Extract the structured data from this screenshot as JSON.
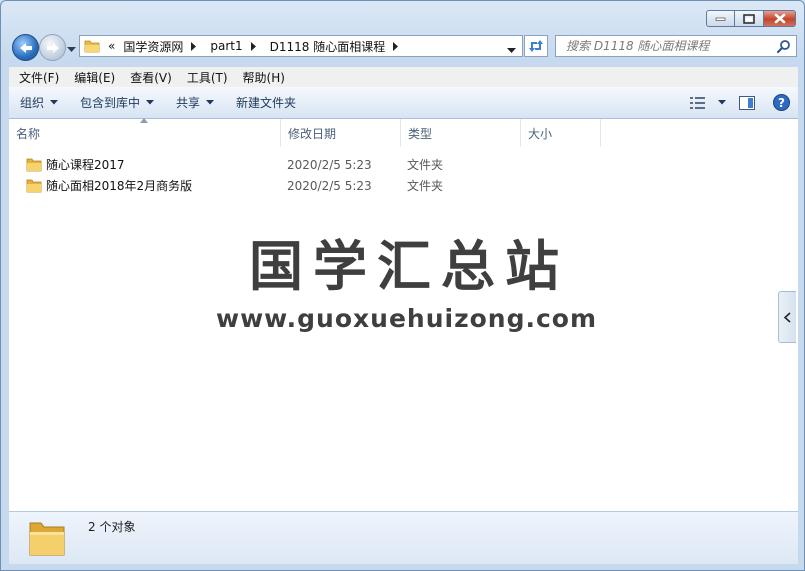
{
  "window": {
    "accent": "#2a6fbe"
  },
  "address": {
    "overflow": "«",
    "crumbs": [
      "国学资源网",
      "part1",
      "D1118 随心面相课程"
    ]
  },
  "search": {
    "placeholder": "搜索 D1118 随心面相课程"
  },
  "menu": [
    "文件(F)",
    "编辑(E)",
    "查看(V)",
    "工具(T)",
    "帮助(H)"
  ],
  "commands": {
    "organize": "组织",
    "include_in_library": "包含到库中",
    "share": "共享",
    "new_folder": "新建文件夹"
  },
  "columns": {
    "name": "名称",
    "date": "修改日期",
    "type": "类型",
    "size": "大小"
  },
  "files": [
    {
      "name": "随心课程2017",
      "date": "2020/2/5 5:23",
      "type": "文件夹",
      "icon": "folder-icon"
    },
    {
      "name": "随心面相2018年2月商务版",
      "date": "2020/2/5 5:23",
      "type": "文件夹",
      "icon": "folder-icon"
    }
  ],
  "watermark": {
    "title": "国学汇总站",
    "url": "www.guoxuehuizong.com"
  },
  "details": {
    "status": "2 个对象"
  }
}
